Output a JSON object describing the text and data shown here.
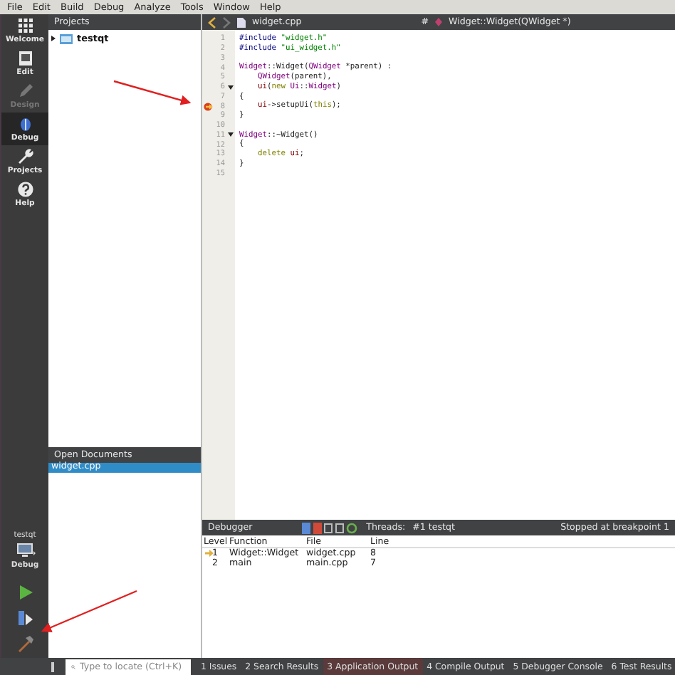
{
  "menu": [
    "File",
    "Edit",
    "Build",
    "Debug",
    "Analyze",
    "Tools",
    "Window",
    "Help"
  ],
  "modes": [
    {
      "label": "Welcome",
      "selected": false,
      "disabled": false
    },
    {
      "label": "Edit",
      "selected": false,
      "disabled": false
    },
    {
      "label": "Design",
      "selected": false,
      "disabled": true
    },
    {
      "label": "Debug",
      "selected": true,
      "disabled": false
    },
    {
      "label": "Projects",
      "selected": false,
      "disabled": false
    },
    {
      "label": "Help",
      "selected": false,
      "disabled": false
    }
  ],
  "kit": {
    "project": "testqt",
    "config": "Debug"
  },
  "projects": {
    "title": "Projects",
    "tree": [
      {
        "label": "testqt",
        "expanded": false
      }
    ]
  },
  "open_documents": {
    "title": "Open Documents",
    "items": [
      {
        "label": "widget.cpp",
        "selected": true
      }
    ]
  },
  "editor": {
    "file": "widget.cpp",
    "symbol_mark": "#",
    "symbol": "Widget::Widget(QWidget *)",
    "lines": [
      {
        "no": "1",
        "segments": [
          {
            "kind": "pre",
            "text": "#include "
          },
          {
            "kind": "str",
            "text": "\"widget.h\""
          }
        ]
      },
      {
        "no": "2",
        "segments": [
          {
            "kind": "pre",
            "text": "#include "
          },
          {
            "kind": "str",
            "text": "\"ui_widget.h\""
          }
        ]
      },
      {
        "no": "3"
      },
      {
        "no": "4",
        "segments": [
          {
            "kind": "type",
            "text": "Widget"
          },
          {
            "kind": "plain",
            "text": "::Widget("
          },
          {
            "kind": "type",
            "text": "QWidget"
          },
          {
            "kind": "plain",
            "text": " *parent) :"
          }
        ]
      },
      {
        "no": "5",
        "segments": [
          {
            "kind": "type",
            "text": "    QWidget"
          },
          {
            "kind": "plain",
            "text": "(parent),"
          }
        ]
      },
      {
        "no": "6",
        "fold": true,
        "segments": [
          {
            "kind": "member",
            "text": "    ui"
          },
          {
            "kind": "plain",
            "text": "("
          },
          {
            "kind": "kw",
            "text": "new "
          },
          {
            "kind": "type",
            "text": "Ui"
          },
          {
            "kind": "plain",
            "text": "::"
          },
          {
            "kind": "type",
            "text": "Widget"
          },
          {
            "kind": "plain",
            "text": ")"
          }
        ]
      },
      {
        "no": "7",
        "segments": [
          {
            "kind": "plain",
            "text": "{"
          }
        ]
      },
      {
        "no": "8",
        "breakpoint": true,
        "segments": [
          {
            "kind": "member",
            "text": "    ui"
          },
          {
            "kind": "plain",
            "text": "->setupUi("
          },
          {
            "kind": "kw",
            "text": "this"
          },
          {
            "kind": "plain",
            "text": ");"
          }
        ]
      },
      {
        "no": "9",
        "segments": [
          {
            "kind": "plain",
            "text": "}"
          }
        ]
      },
      {
        "no": "10"
      },
      {
        "no": "11",
        "fold": true,
        "segments": [
          {
            "kind": "type",
            "text": "Widget"
          },
          {
            "kind": "plain",
            "text": "::~Widget()"
          }
        ]
      },
      {
        "no": "12",
        "segments": [
          {
            "kind": "plain",
            "text": "{"
          }
        ]
      },
      {
        "no": "13",
        "segments": [
          {
            "kind": "kw",
            "text": "    delete "
          },
          {
            "kind": "member",
            "text": "ui"
          },
          {
            "kind": "plain",
            "text": ";"
          }
        ]
      },
      {
        "no": "14",
        "segments": [
          {
            "kind": "plain",
            "text": "}"
          }
        ]
      },
      {
        "no": "15"
      }
    ]
  },
  "debugger": {
    "title": "Debugger",
    "threads_label": "Threads:",
    "thread": "#1 testqt",
    "status": "Stopped at breakpoint 1",
    "columns": [
      "Level",
      "Function",
      "File",
      "Line"
    ],
    "rows": [
      {
        "cells": [
          "1",
          "Widget::Widget",
          "widget.cpp",
          "8"
        ],
        "current": true
      },
      {
        "cells": [
          "2",
          "main",
          "main.cpp",
          "7"
        ],
        "current": false
      }
    ]
  },
  "locator": {
    "placeholder": "Type to locate (Ctrl+K)"
  },
  "output_tabs": [
    {
      "label": "1  Issues",
      "selected": false
    },
    {
      "label": "2  Search Results",
      "selected": false
    },
    {
      "label": "3  Application Output",
      "selected": true
    },
    {
      "label": "4  Compile Output",
      "selected": false
    },
    {
      "label": "5  Debugger Console",
      "selected": false
    },
    {
      "label": "6  Test Results",
      "selected": false
    }
  ]
}
